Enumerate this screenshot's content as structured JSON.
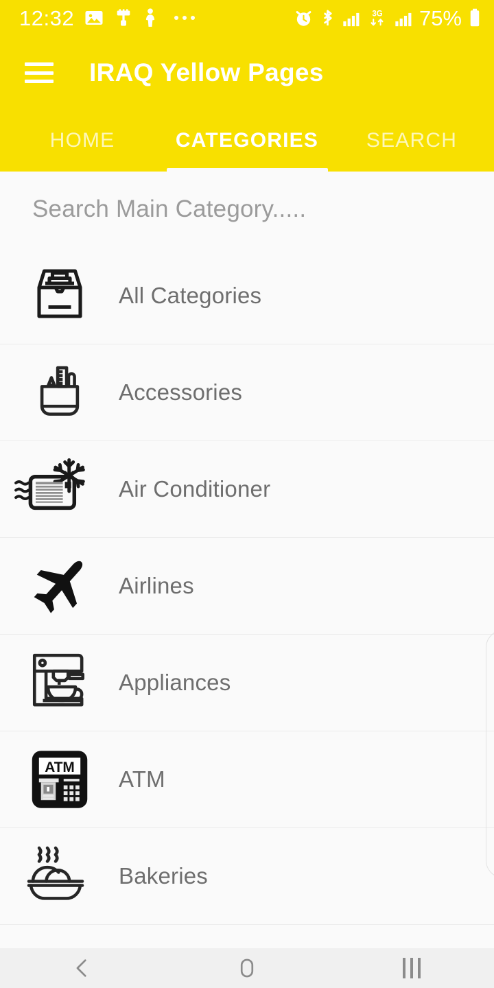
{
  "statusbar": {
    "time": "12:32",
    "battery_percent": "75%",
    "left_icons": [
      "image-icon",
      "paintbrush-icon",
      "person-icon",
      "overflow-dots-icon"
    ],
    "right_icons": [
      "alarm-icon",
      "bluetooth-icon",
      "signal-bars-icon",
      "network-3g-icon",
      "signal-bars-icon",
      "battery-icon"
    ],
    "network_label": "3G"
  },
  "appbar": {
    "menu_icon": "hamburger-menu-icon",
    "title": "IRAQ Yellow Pages",
    "brand_color": "#f8e000",
    "title_color": "#ffffff"
  },
  "tabs": {
    "items": [
      {
        "label": "HOME",
        "active": false
      },
      {
        "label": "CATEGORIES",
        "active": true
      },
      {
        "label": "SEARCH",
        "active": false
      }
    ],
    "indicator_color": "#fafafa"
  },
  "search": {
    "placeholder": "Search Main Category.....",
    "value": ""
  },
  "categories": {
    "items": [
      {
        "label": "All Categories",
        "icon": "file-tray-icon"
      },
      {
        "label": "Accessories",
        "icon": "pen-holder-icon"
      },
      {
        "label": "Air Conditioner",
        "icon": "air-conditioner-icon"
      },
      {
        "label": "Airlines",
        "icon": "airplane-icon"
      },
      {
        "label": "Appliances",
        "icon": "coffee-machine-icon"
      },
      {
        "label": "ATM",
        "icon": "atm-machine-icon",
        "icon_text": "ATM"
      },
      {
        "label": "Bakeries",
        "icon": "bread-basket-icon"
      },
      {
        "label": "",
        "icon": "partial-cut-off-icon"
      }
    ],
    "label_color": "#6e6e6e",
    "divider_color": "#ececec",
    "background": "#fafafa"
  },
  "navbar": {
    "buttons": [
      {
        "name": "back",
        "icon": "chevron-left-icon"
      },
      {
        "name": "home",
        "icon": "home-rounded-square-icon"
      },
      {
        "name": "recents",
        "icon": "recents-bars-icon"
      }
    ],
    "background": "#f0f0f0",
    "icon_color": "#8b8b8b"
  }
}
